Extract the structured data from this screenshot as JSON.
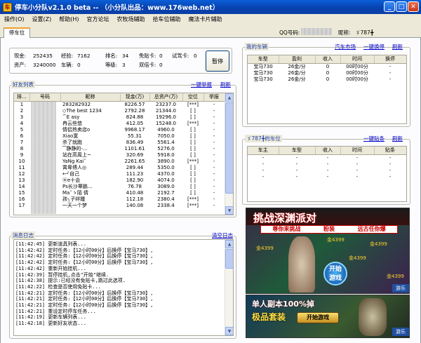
{
  "window": {
    "title": "停车小分队v2.1.0 beta -- （小分队出品：www.176web.net）",
    "min": "_",
    "max": "□",
    "close": "✕"
  },
  "menu": [
    "操作(O)",
    "设置(Z)",
    "帮助(H)",
    "官方论坛",
    "农牧场辅助",
    "拾车位辅助",
    "魔法卡片辅助"
  ],
  "tab": "停车位",
  "account": {
    "qq_label": "QQ号码:",
    "nick_label": "昵称:",
    "nick_value": "ゞ787╋"
  },
  "stats": {
    "row1": [
      {
        "l": "现金:",
        "v": "252435"
      },
      {
        "l": "经验:",
        "v": "7162"
      },
      {
        "l": "排名:",
        "v": "34"
      },
      {
        "l": "免贴卡:",
        "v": "0"
      },
      {
        "l": "试驾卡:",
        "v": "0"
      }
    ],
    "row2": [
      {
        "l": "资产:",
        "v": "3240000"
      },
      {
        "l": "车辆:",
        "v": "0"
      },
      {
        "l": "等级:",
        "v": "3"
      },
      {
        "l": "双倍卡:",
        "v": "0"
      }
    ],
    "pause": "暂停"
  },
  "friends": {
    "title": "好友列表",
    "links": [
      "一键举报",
      "刷新"
    ],
    "columns": [
      "排...",
      "号码",
      "昵称",
      "现金(万)",
      "总资产(万)",
      "空位",
      "举报"
    ],
    "rows": [
      [
        "1",
        "",
        "283282932",
        "8226.57",
        "23237.0",
        "[***]",
        "-"
      ],
      [
        "2",
        "",
        "◇The best 1234",
        "2792.28",
        "21344.0",
        "[ ]",
        "-"
      ],
      [
        "3",
        "",
        "˚ ̄E asy",
        "824.88",
        "19296.0",
        "[ ]",
        "-"
      ],
      [
        "4",
        "",
        "冉云些悠",
        "412.05",
        "15248.0",
        "[***]",
        "-"
      ],
      [
        "5",
        "",
        "情侣热卖店o",
        "9968.17",
        "4960.0",
        "[ ]",
        "-"
      ],
      [
        "6",
        "",
        "Xiao寞",
        "55.31",
        "7050.0",
        "[ ]",
        "-"
      ],
      [
        "7",
        "",
        "杀了就跑",
        "836.49",
        "5561.4",
        "[ ]",
        "-"
      ],
      [
        "8",
        "",
        "▔静静的-...",
        "1101.61",
        "5276.0",
        "[ ]",
        "-"
      ],
      [
        "9",
        "",
        "站在高周上~",
        "320.69",
        "5918.0",
        "[ ]",
        "-"
      ],
      [
        "10",
        "",
        "YaNg Kai˘",
        "2261.65",
        "3890.0",
        "[***]",
        "-"
      ],
      [
        "11",
        "",
        "霄卑傅人◎",
        "289.44",
        "5350.0",
        "[ ]",
        "-"
      ],
      [
        "12",
        "",
        "←╯自己",
        "111.23",
        "4370.0",
        "[ ]",
        "-"
      ],
      [
        "13",
        "",
        "ⓦe十会",
        "182.90",
        "4074.0",
        "[ ]",
        "-"
      ],
      [
        "14",
        "",
        "Ρs长沙覃鹏...",
        "76.78",
        "3089.0",
        "[ ]",
        "-"
      ],
      [
        "15",
        "",
        "Ma˘ゝ陌 倩",
        "410.48",
        "2192.7",
        "[ ]",
        "-"
      ],
      [
        "16",
        "",
        "孩╮子绊踵",
        "112.18",
        "2380.4",
        "[***]",
        "-"
      ],
      [
        "17",
        "",
        "一天一个梦",
        "140.08",
        "2338.4",
        "[***]",
        "-"
      ]
    ]
  },
  "log": {
    "title": "消息日志",
    "clear": "清空日志",
    "lines": [
      "[11:42:45] 更新道具列表...",
      "[11:42:42] 定时任务:【12小时00分】后换停【宝马730】,",
      "[11:42:42] 定时任务:【12小时00分】后换停【宝马730】,",
      "[11:42:42] 定时任务:【12小时00分】后换停【宝马730】,",
      "[11:42:42] 重新开始挂机...",
      "[11:42:39] 暂停挂机,点击\"开始\"继续.",
      "[11:42:38] 提示:已经没有免贴卡,跳过此选项.",
      "[11:42:22] 检查是否使用免贴卡...",
      "[11:42:21] 定时任务:【12小时00分】后换停【宝马730】,",
      "[11:42:21] 定时任务:【12小时00分】后换停【宝马730】,",
      "[11:42:21] 定时任务:【12小时00分】后换停【宝马730】,",
      "[11:42:21] 重设定时停车任务...",
      "[11:42:19] 更新车辆列表...",
      "[11:42:18] 更新好友状态..."
    ]
  },
  "mycars": {
    "title": "我的车辆",
    "links": [
      "汽车市场",
      "一键换停",
      "刷新"
    ],
    "columns": [
      "车型",
      "盈利",
      "收入",
      "时间",
      "换停"
    ],
    "rows": [
      [
        "宝马730",
        "26金/分",
        "0",
        "00时00分",
        "-"
      ],
      [
        "宝马730",
        "26金/分",
        "0",
        "00时00分",
        "-"
      ],
      [
        "宝马730",
        "26金/分",
        "0",
        "00时00分",
        "-"
      ]
    ]
  },
  "spots": {
    "title": "ゞ787╋的车位",
    "links": [
      "一键贴条",
      "刷新"
    ],
    "columns": [
      "车主",
      "车型",
      "收入",
      "时间",
      "贴条"
    ],
    "rows": [
      [
        "-",
        "-",
        "-",
        "-",
        "-"
      ],
      [
        "-",
        "-",
        "-",
        "-",
        "-"
      ],
      [
        "-",
        "-",
        "-",
        "-",
        "-"
      ],
      [
        "-",
        "-",
        "-",
        "-",
        "-"
      ]
    ]
  },
  "ads": {
    "ad1": {
      "title": "挑战深渊派对",
      "sub": [
        "尊你来挑战",
        "粉装",
        "远古任你爆"
      ],
      "coins": [
        "金4399",
        "金4399",
        "金4399",
        "金4399",
        "金4399"
      ],
      "start1": "开始",
      "start2": "游戏",
      "brand": "游乐"
    },
    "ad2": {
      "line1": "单人副本100%掉",
      "line2": "极品套装",
      "btn": "开始游戏",
      "brand": "游乐"
    }
  }
}
